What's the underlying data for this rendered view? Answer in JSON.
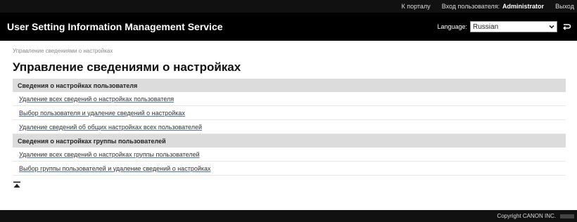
{
  "topbar": {
    "portal_link": "К порталу",
    "login_label": "Вход пользователя:",
    "user_name": "Administrator",
    "logout_link": "Выход"
  },
  "header": {
    "app_title": "User Setting Information Management Service",
    "language_label": "Language:",
    "language_value": "Russian"
  },
  "main": {
    "breadcrumb": "Управление сведениями о настройках",
    "title": "Управление сведениями о настройках",
    "sections": [
      {
        "header": "Сведения о настройках пользователя",
        "links": [
          "Удаление всех сведений о настройках пользователя",
          "Выбор пользователя и удаление сведений о настройках",
          "Удаление сведений об общих настройках всех пользователей"
        ]
      },
      {
        "header": "Сведения о настройках группы пользователей",
        "links": [
          "Удаление всех сведений о настройках группы пользователей",
          "Выбор группы пользователей и удаление сведений о настройках"
        ]
      }
    ]
  },
  "footer": {
    "copyright": "Copyright CANON INC."
  }
}
